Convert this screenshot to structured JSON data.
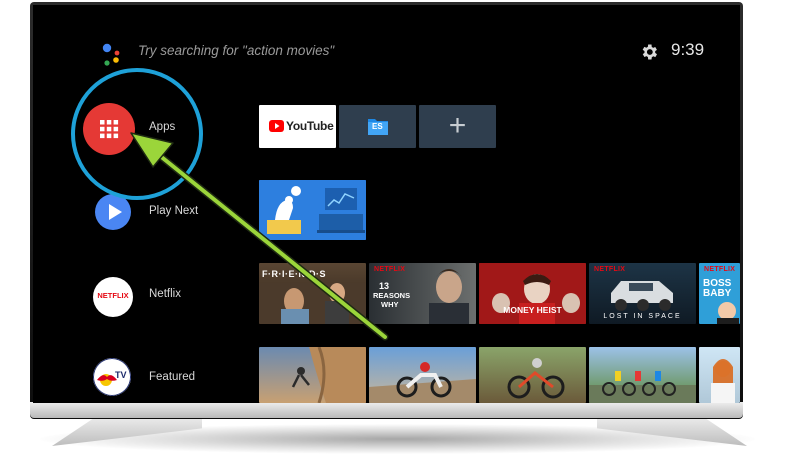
{
  "search": {
    "hint": "Try searching for \"action movies\""
  },
  "status": {
    "time": "9:39"
  },
  "rail": {
    "apps_label": "Apps",
    "play_next_label": "Play Next",
    "netflix_label": "Netflix",
    "netflix_logo": "NETFLIX",
    "featured_label": "Featured",
    "featured_logo": "TV"
  },
  "apps_row": {
    "youtube_label": "YouTube",
    "es_label": "ES",
    "add_symbol": "+"
  },
  "netflix_row": {
    "badge": "NETFLIX",
    "friends_title": "F·R·I·E·N·D·S",
    "reasons_line1": "13",
    "reasons_line2": "REASONS",
    "reasons_line3": "WHY",
    "money_heist_title": "MONEY HEIST",
    "lost_in_space_title": "LOST IN SPACE",
    "boss_baby_line1": "BOSS",
    "boss_baby_line2": "BABY"
  },
  "colors": {
    "apps_red": "#e53935",
    "play_blue": "#4a86f3",
    "ring_blue": "#1ea1d8",
    "arrow_green": "#9bd53a",
    "netflix_red": "#e50914",
    "youtube_red": "#ff0000"
  }
}
